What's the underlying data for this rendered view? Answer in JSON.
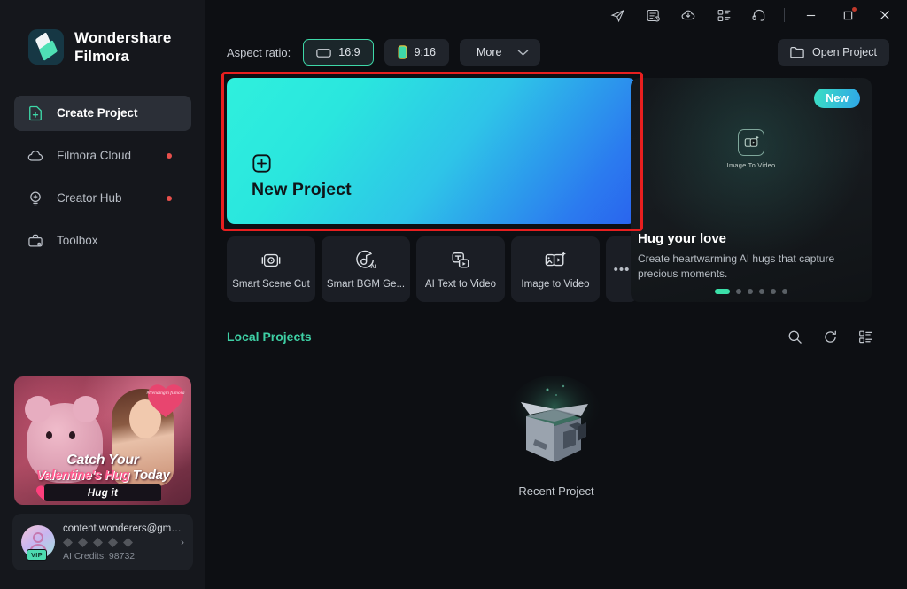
{
  "app": {
    "brand_line1": "Wondershare",
    "brand_line2": "Filmora"
  },
  "titlebar": {
    "icons": [
      {
        "name": "share-icon",
        "label": "Share"
      },
      {
        "name": "task-list-icon",
        "label": "Tasks"
      },
      {
        "name": "cloud-download-icon",
        "label": "Cloud"
      },
      {
        "name": "apps-grid-icon",
        "label": "Apps"
      },
      {
        "name": "headset-support-icon",
        "label": "Support"
      }
    ],
    "minimize": "Minimize",
    "maximize": "Maximize",
    "close": "Close"
  },
  "sidebar": {
    "items": [
      {
        "label": "Create Project",
        "icon": "new-document-icon",
        "active": true,
        "dot": false
      },
      {
        "label": "Filmora Cloud",
        "icon": "cloud-icon",
        "active": false,
        "dot": true
      },
      {
        "label": "Creator Hub",
        "icon": "creator-hub-icon",
        "active": false,
        "dot": true
      },
      {
        "label": "Toolbox",
        "icon": "toolbox-icon",
        "active": false,
        "dot": false
      }
    ],
    "promo": {
      "line1": "Catch Your",
      "line2_accent": "Valentine's Hug",
      "line2_plain": "Today",
      "cta": "Hug it",
      "tag": "#trendingin filmora"
    },
    "profile": {
      "email": "content.wonderers@gmail...",
      "vip": "VIP",
      "credits": "AI Credits: 98732",
      "chevron": "›"
    }
  },
  "toolbar": {
    "aspect_label": "Aspect ratio:",
    "ratios": [
      {
        "label": "16:9",
        "icon": "landscape-frame-icon",
        "selected": true
      },
      {
        "label": "9:16",
        "icon": "portrait-frame-icon",
        "selected": false
      }
    ],
    "more_label": "More",
    "open_project_label": "Open Project"
  },
  "main": {
    "new_project": {
      "title": "New Project",
      "icon": "plus-square-icon",
      "highlighted": true
    },
    "tools": [
      {
        "label": "Smart Scene Cut",
        "icon": "scene-cut-icon"
      },
      {
        "label": "Smart BGM Ge...",
        "icon": "bgm-ai-icon"
      },
      {
        "label": "AI Text to Video",
        "icon": "text-to-video-icon"
      },
      {
        "label": "Image to Video",
        "icon": "image-to-video-icon"
      }
    ],
    "tools_more": "•••",
    "promo_card": {
      "badge": "New",
      "feature_label": "Image To Video",
      "title": "Hug your love",
      "description": "Create heartwarming AI hugs that capture precious moments.",
      "dots_total": 6,
      "dots_active_index": 0
    },
    "local_projects": {
      "title": "Local Projects",
      "actions": [
        {
          "name": "search-icon",
          "label": "Search"
        },
        {
          "name": "refresh-icon",
          "label": "Refresh"
        },
        {
          "name": "view-list-icon",
          "label": "View"
        }
      ],
      "empty_label": "Recent Project"
    }
  },
  "colors": {
    "accent_green": "#3ecfa4",
    "highlight_red": "#e81f1f",
    "gradient_start": "#2ff0dd",
    "gradient_end": "#2a63ee",
    "sidebar_bg": "#15171c",
    "main_bg": "#0d0f13",
    "notification_dot": "#e8504c"
  }
}
